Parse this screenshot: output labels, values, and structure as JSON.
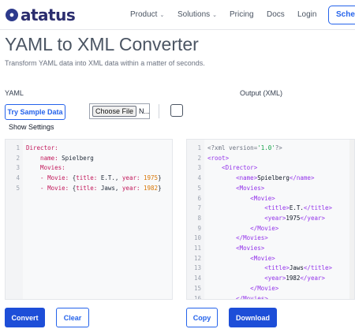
{
  "nav": {
    "logo_text": "atatus",
    "items": [
      {
        "label": "Product",
        "dropdown": true
      },
      {
        "label": "Solutions",
        "dropdown": true
      },
      {
        "label": "Pricing",
        "dropdown": false
      },
      {
        "label": "Docs",
        "dropdown": false
      },
      {
        "label": "Login",
        "dropdown": false
      }
    ],
    "cta_label": "Schedule"
  },
  "page": {
    "title": "YAML to XML Converter",
    "subtitle": "Transform YAML data into XML data within a matter of seconds."
  },
  "input": {
    "label": "YAML",
    "sample_button": "Try Sample Data",
    "file_button": "Choose File",
    "file_status": "N...",
    "show_settings": "Show Settings",
    "lines": [
      [
        {
          "t": "Director:",
          "c": "k-red"
        }
      ],
      [
        {
          "t": "    name: ",
          "c": "k-red"
        },
        {
          "t": "Spielberg",
          "c": "k-dark"
        }
      ],
      [
        {
          "t": "    Movies:",
          "c": "k-red"
        }
      ],
      [
        {
          "t": "    - Movie: ",
          "c": "k-red"
        },
        {
          "t": "{",
          "c": "k-dark"
        },
        {
          "t": "title: ",
          "c": "k-red"
        },
        {
          "t": "E.T., ",
          "c": "k-dark"
        },
        {
          "t": "year: ",
          "c": "k-red"
        },
        {
          "t": "1975",
          "c": "k-num"
        },
        {
          "t": "}",
          "c": "k-dark"
        }
      ],
      [
        {
          "t": "    - Movie: ",
          "c": "k-red"
        },
        {
          "t": "{",
          "c": "k-dark"
        },
        {
          "t": "title: ",
          "c": "k-red"
        },
        {
          "t": "Jaws, ",
          "c": "k-dark"
        },
        {
          "t": "year: ",
          "c": "k-red"
        },
        {
          "t": "1982",
          "c": "k-num"
        },
        {
          "t": "}",
          "c": "k-dark"
        }
      ]
    ]
  },
  "output": {
    "label": "Output (XML)",
    "lines": [
      [
        {
          "t": "<?xml version=",
          "c": "x-decl"
        },
        {
          "t": "'1.0'",
          "c": "x-str"
        },
        {
          "t": "?>",
          "c": "x-decl"
        }
      ],
      [
        {
          "t": "<root>",
          "c": "x-tag"
        }
      ],
      [
        {
          "t": "    <Director>",
          "c": "x-tag"
        }
      ],
      [
        {
          "t": "        <name>",
          "c": "x-tag"
        },
        {
          "t": "Spielberg",
          "c": "x-text"
        },
        {
          "t": "</name>",
          "c": "x-tag"
        }
      ],
      [
        {
          "t": "        <Movies>",
          "c": "x-tag"
        }
      ],
      [
        {
          "t": "            <Movie>",
          "c": "x-tag"
        }
      ],
      [
        {
          "t": "                <title>",
          "c": "x-tag"
        },
        {
          "t": "E.T.",
          "c": "x-text"
        },
        {
          "t": "</title>",
          "c": "x-tag"
        }
      ],
      [
        {
          "t": "                <year>",
          "c": "x-tag"
        },
        {
          "t": "1975",
          "c": "x-text"
        },
        {
          "t": "</year>",
          "c": "x-tag"
        }
      ],
      [
        {
          "t": "            </Movie>",
          "c": "x-tag"
        }
      ],
      [
        {
          "t": "        </Movies>",
          "c": "x-tag"
        }
      ],
      [
        {
          "t": "        <Movies>",
          "c": "x-tag"
        }
      ],
      [
        {
          "t": "            <Movie>",
          "c": "x-tag"
        }
      ],
      [
        {
          "t": "                <title>",
          "c": "x-tag"
        },
        {
          "t": "Jaws",
          "c": "x-text"
        },
        {
          "t": "</title>",
          "c": "x-tag"
        }
      ],
      [
        {
          "t": "                <year>",
          "c": "x-tag"
        },
        {
          "t": "1982",
          "c": "x-text"
        },
        {
          "t": "</year>",
          "c": "x-tag"
        }
      ],
      [
        {
          "t": "            </Movie>",
          "c": "x-tag"
        }
      ],
      [
        {
          "t": "        </Movies>",
          "c": "x-tag"
        }
      ]
    ]
  },
  "actions": {
    "convert": "Convert",
    "clear": "Clear",
    "copy": "Copy",
    "download": "Download"
  },
  "colors": {
    "accent": "#2563eb",
    "accent_dark": "#1d4ed8",
    "logo": "#2b2d6e"
  }
}
